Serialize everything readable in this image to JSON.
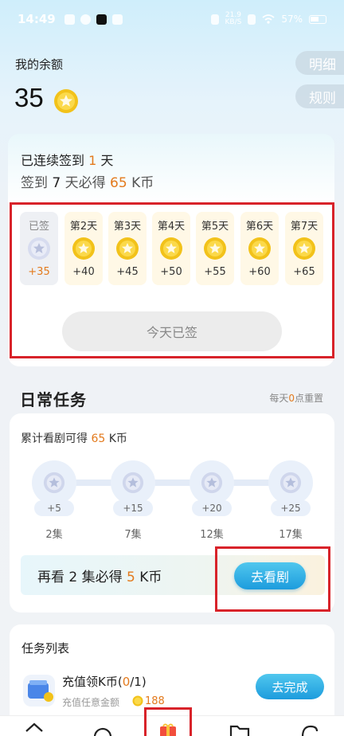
{
  "status_bar": {
    "time": "14:49",
    "net_speed_top": "21.9",
    "net_speed_unit": "KB/S",
    "battery": "57%"
  },
  "balance": {
    "label": "我的余额",
    "amount": "35",
    "coin_icon": "gold-coin-icon"
  },
  "side_buttons": {
    "detail": "明细",
    "rules": "规则"
  },
  "signin": {
    "streak_prefix": "已连续签到 ",
    "streak_days": "1",
    "streak_suffix": " 天",
    "goal_prefix": "签到 ",
    "goal_days": "7",
    "goal_middle": " 天必得 ",
    "goal_amount": "65",
    "goal_suffix": " K币",
    "days": [
      {
        "label": "已签",
        "reward": "+35",
        "done": true
      },
      {
        "label": "第2天",
        "reward": "+40",
        "done": false
      },
      {
        "label": "第3天",
        "reward": "+45",
        "done": false
      },
      {
        "label": "第4天",
        "reward": "+50",
        "done": false
      },
      {
        "label": "第5天",
        "reward": "+55",
        "done": false
      },
      {
        "label": "第6天",
        "reward": "+60",
        "done": false
      },
      {
        "label": "第7天",
        "reward": "+65",
        "done": false
      }
    ],
    "button_label": "今天已签"
  },
  "daily": {
    "title": "日常任务",
    "reset_prefix": "每天",
    "reset_hour": "0",
    "reset_suffix": "点重置",
    "watch_prefix": "累计看剧可得 ",
    "watch_amount": "65",
    "watch_suffix": " K币",
    "milestones": [
      {
        "reward": "+5",
        "episodes": "2集"
      },
      {
        "reward": "+15",
        "episodes": "7集"
      },
      {
        "reward": "+20",
        "episodes": "12集"
      },
      {
        "reward": "+25",
        "episodes": "17集"
      }
    ],
    "banner_prefix": "再看 ",
    "banner_count": "2",
    "banner_middle": " 集必得 ",
    "banner_amount": "5",
    "banner_suffix": " K币",
    "go_watch_label": "去看剧"
  },
  "task_list": {
    "title": "任务列表",
    "tasks": [
      {
        "name_prefix": "充值领K币(",
        "progress_done": "0",
        "progress_total": "/1)",
        "subtitle": "充值任意金额",
        "amount": "188",
        "button_label": "去完成"
      }
    ]
  },
  "bottom_nav": {
    "items": [
      "home-icon",
      "play-icon",
      "welfare-gift-icon",
      "folder-icon",
      "profile-icon"
    ]
  },
  "colors": {
    "accent_orange": "#e37a1d",
    "accent_blue": "#1d9cdd",
    "highlight_red": "#d8232a",
    "coin_gold": "#f2c21a"
  }
}
